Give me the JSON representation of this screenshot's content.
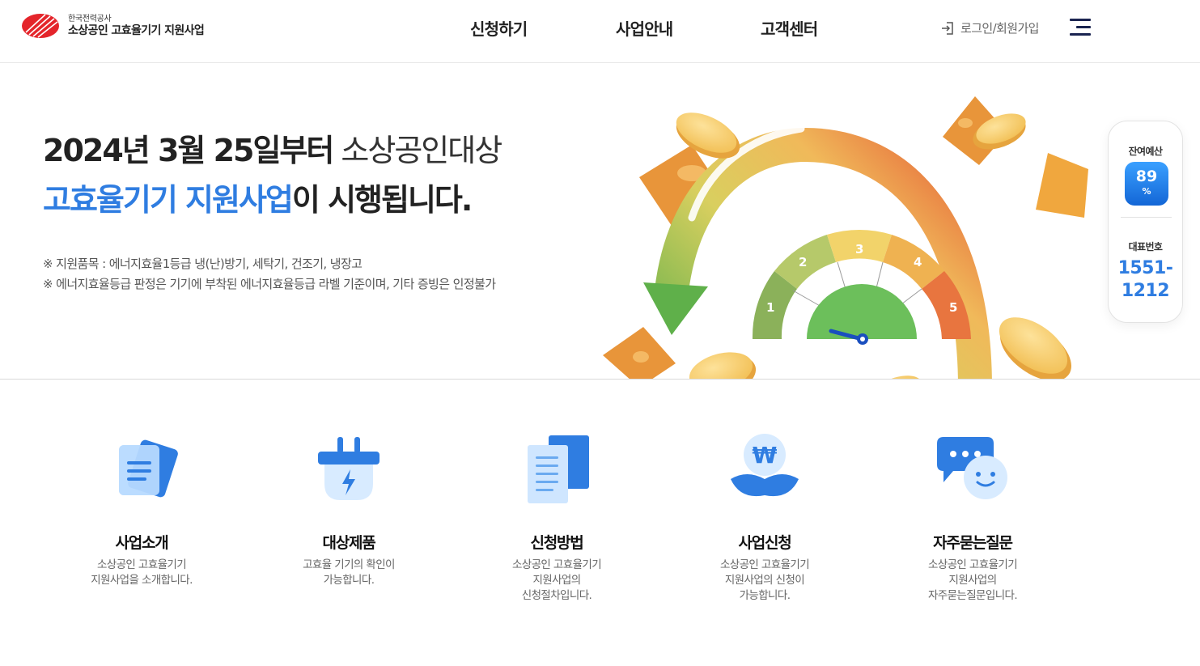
{
  "header": {
    "logo_sub": "한국전력공사",
    "logo_main": "소상공인 고효율기기 지원사업",
    "nav": [
      {
        "label": "신청하기"
      },
      {
        "label": "사업안내"
      },
      {
        "label": "고객센터"
      }
    ],
    "login_label": "로그인/회원가입",
    "login_icon": "login-icon",
    "menu_icon": "hamburger-menu-icon"
  },
  "hero": {
    "line1_bold": "2024년 3월 25일부터",
    "line1_light": " 소상공인대상",
    "line2_blue": "고효율기기 지원사업",
    "line2_rest": "이 시행됩니다.",
    "notes": [
      "※ 지원품목 : 에너지효율1등급 냉(난)방기, 세탁기, 건조기, 냉장고",
      "※ 에너지효율등급 판정은 기기에 부착된 에너지효율등급 라벨 기준이며, 기타 증빙은 인정불가"
    ],
    "gauge_labels": [
      "1",
      "2",
      "3",
      "4",
      "5"
    ],
    "colors": {
      "accent_blue": "#2f7de1",
      "gauge_green": "#6cbf5b",
      "gauge_orange": "#e8753f",
      "coin_yellow": "#f5cf6a"
    }
  },
  "side_widget": {
    "budget_label": "잔여예산",
    "budget_value": "89",
    "budget_unit": "%",
    "phone_label": "대표번호",
    "phone_line1": "1551-",
    "phone_line2": "1212"
  },
  "quick_menu": [
    {
      "title": "사업소개",
      "desc1": "소상공인 고효율기기",
      "desc2": "지원사업을 소개합니다.",
      "desc3": "",
      "icon": "document-icon"
    },
    {
      "title": "대상제품",
      "desc1": "고효율 기기의 확인이",
      "desc2": "가능합니다.",
      "desc3": "",
      "icon": "plug-icon"
    },
    {
      "title": "신청방법",
      "desc1": "소상공인 고효율기기",
      "desc2": "지원사업의",
      "desc3": "신청절차입니다.",
      "icon": "paper-stack-icon"
    },
    {
      "title": "사업신청",
      "desc1": "소상공인 고효율기기",
      "desc2": "지원사업의 신청이",
      "desc3": "가능합니다.",
      "icon": "won-sprout-icon"
    },
    {
      "title": "자주묻는질문",
      "desc1": "소상공인 고효율기기",
      "desc2": "지원사업의",
      "desc3": "자주묻는질문입니다.",
      "icon": "chat-bubble-icon"
    }
  ]
}
